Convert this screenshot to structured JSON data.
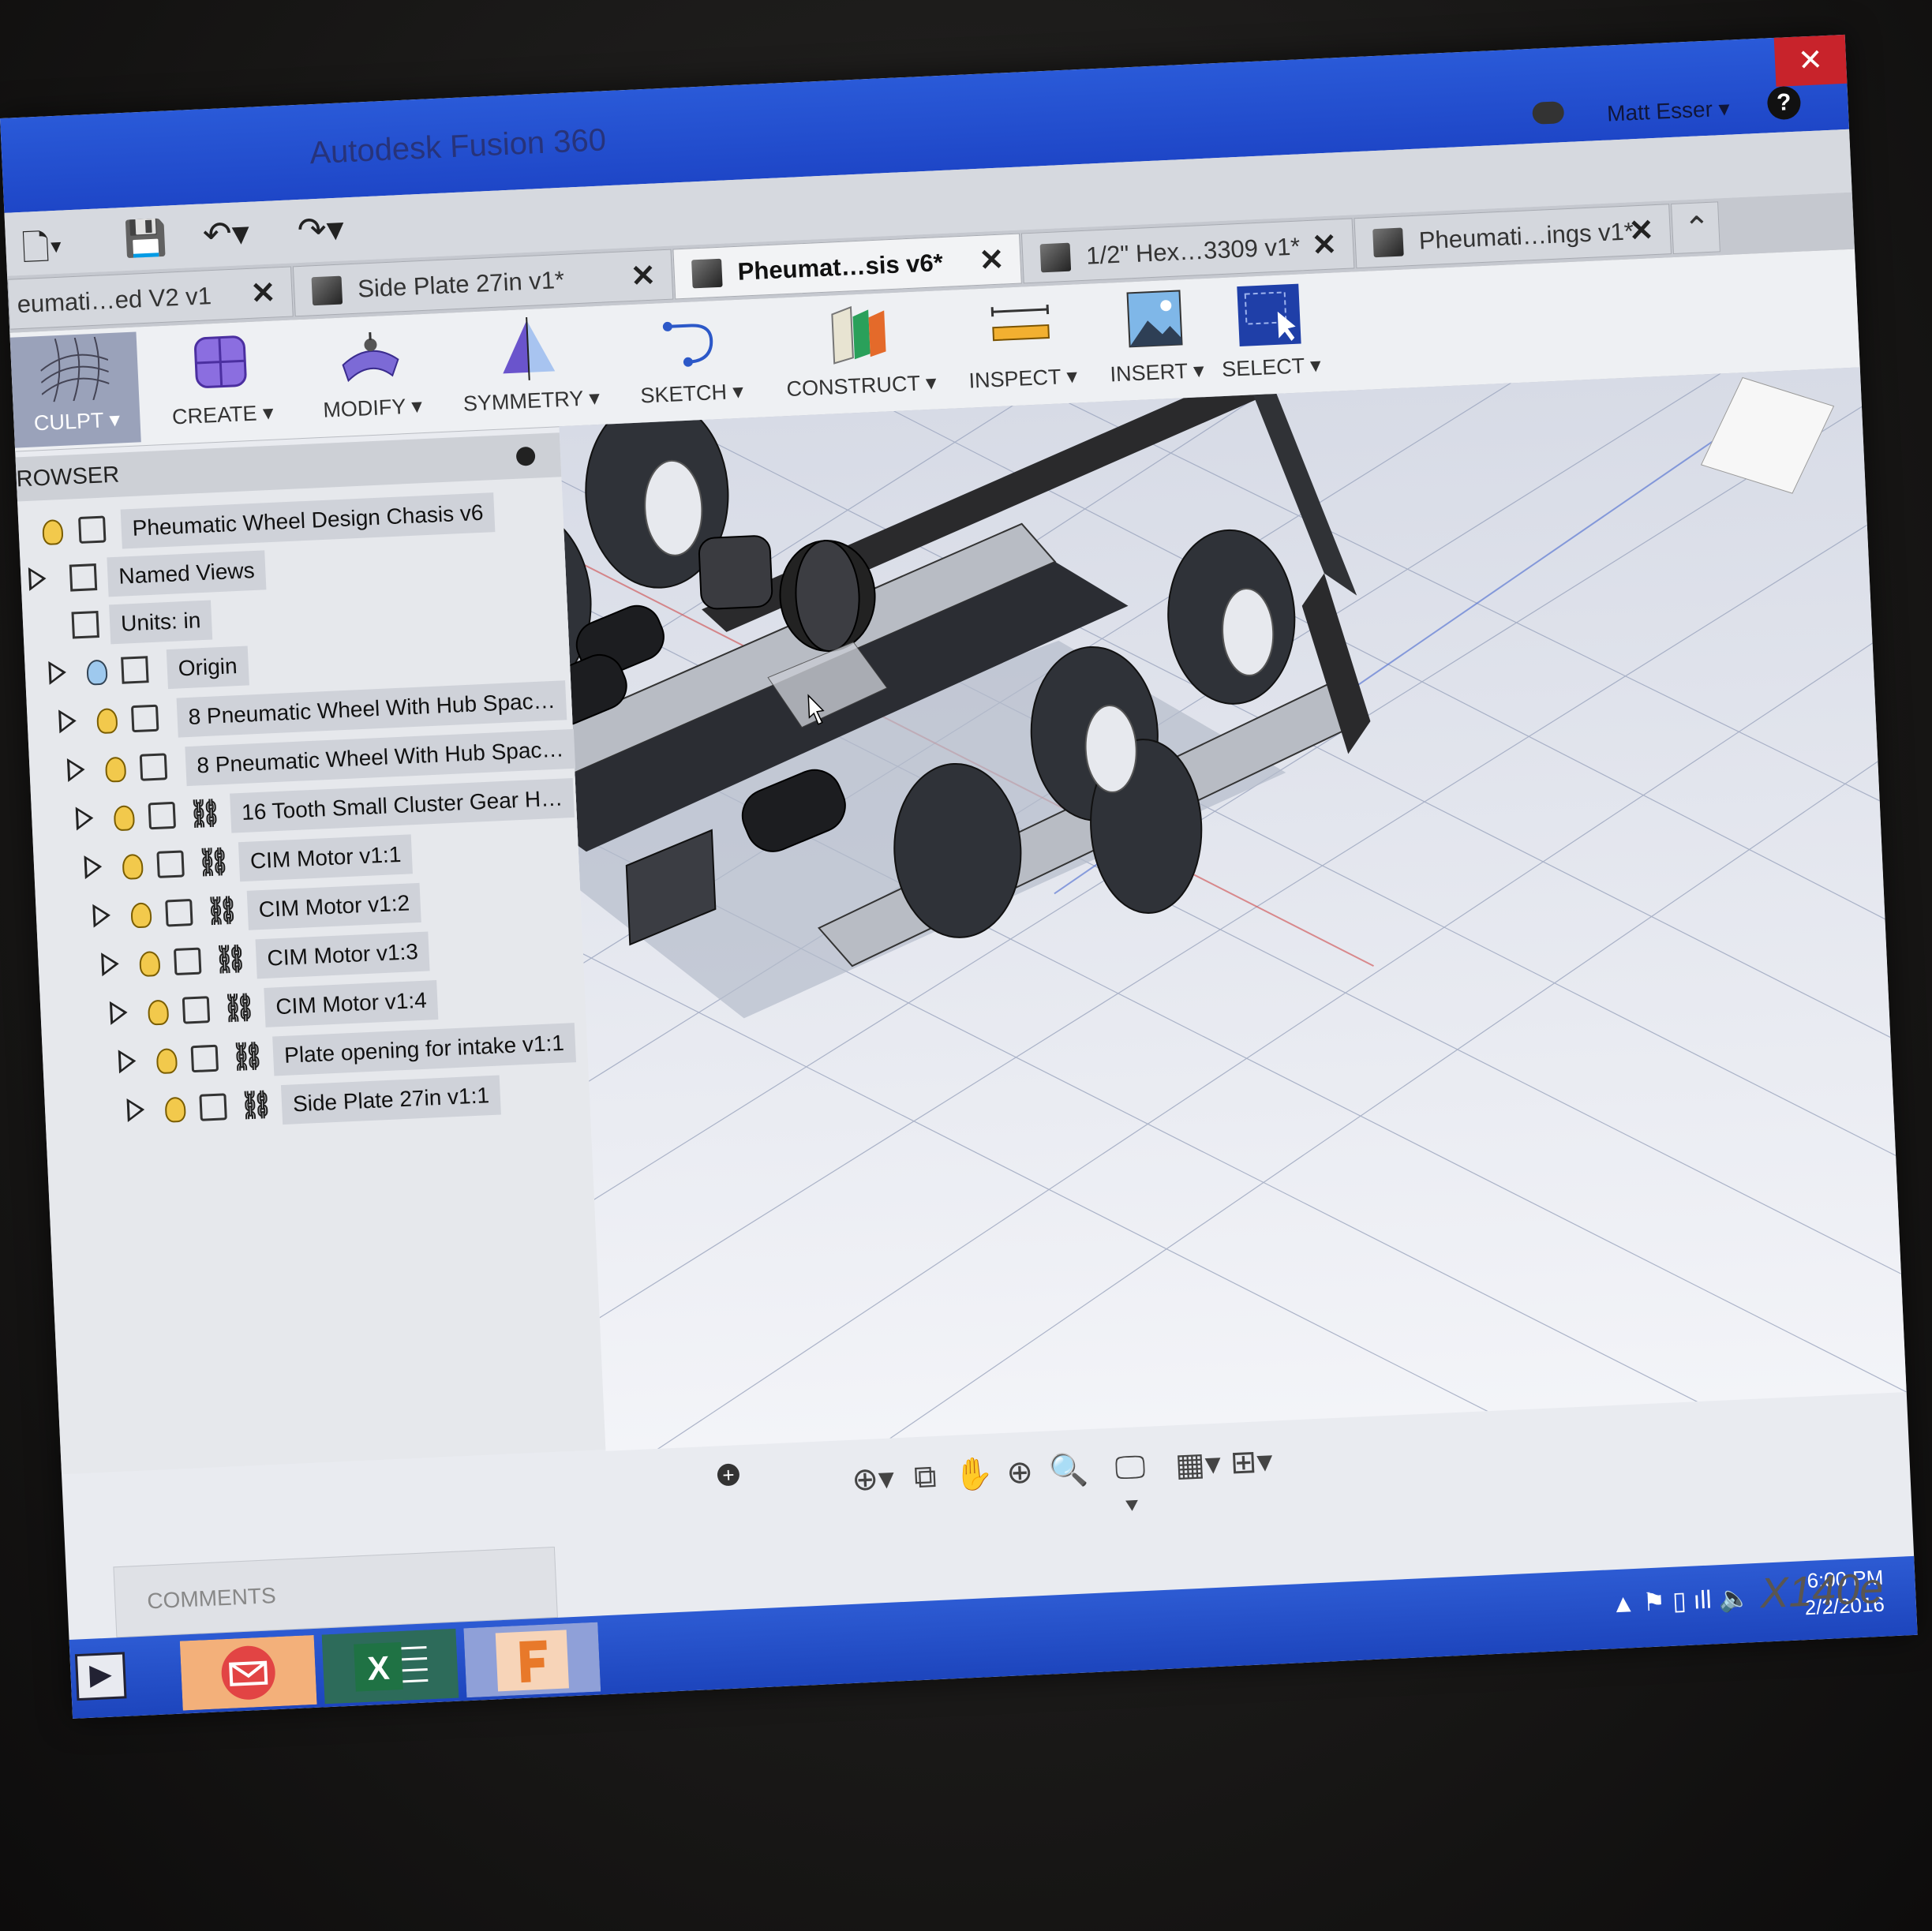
{
  "window": {
    "title": "Autodesk Fusion 360",
    "close_glyph": "✕"
  },
  "account": {
    "user": "Matt Esser ▾",
    "help": "?"
  },
  "quick_access": {
    "file": "🗋▾",
    "save": "💾",
    "undo": "↶▾",
    "redo": "↷▾"
  },
  "tabs": [
    {
      "label": "eumati…ed V2 v1",
      "active": false
    },
    {
      "label": "Side Plate 27in v1*",
      "active": false
    },
    {
      "label": "Pheumat…sis v6*",
      "active": true
    },
    {
      "label": "1/2\" Hex…3309 v1*",
      "active": false
    },
    {
      "label": "Pheumati…ings v1*",
      "active": false
    }
  ],
  "tab_close": "✕",
  "tab_overflow": "⌃",
  "ribbon": [
    {
      "label": "CULPT ▾",
      "icon": "sculpt-icon"
    },
    {
      "label": "CREATE ▾",
      "icon": "create-icon"
    },
    {
      "label": "MODIFY ▾",
      "icon": "modify-icon"
    },
    {
      "label": "SYMMETRY ▾",
      "icon": "symmetry-icon"
    },
    {
      "label": "SKETCH ▾",
      "icon": "sketch-icon"
    },
    {
      "label": "CONSTRUCT ▾",
      "icon": "construct-icon"
    },
    {
      "label": "INSPECT ▾",
      "icon": "inspect-icon"
    },
    {
      "label": "INSERT ▾",
      "icon": "insert-icon"
    },
    {
      "label": "SELECT ▾",
      "icon": "select-icon"
    }
  ],
  "browser": {
    "title": "ROWSER",
    "items": [
      {
        "label": "Pheumatic Wheel Design Chasis v6",
        "arrow": false,
        "bulb": "yellow",
        "link": false
      },
      {
        "label": "Named Views",
        "arrow": true,
        "bulb": "none",
        "link": false
      },
      {
        "label": "Units: in",
        "arrow": false,
        "bulb": "none",
        "link": false
      },
      {
        "label": "Origin",
        "arrow": true,
        "bulb": "blue",
        "link": false
      },
      {
        "label": "8 Pneumatic Wheel With Hub Spac…",
        "arrow": true,
        "bulb": "yellow",
        "link": false
      },
      {
        "label": "8 Pneumatic Wheel With Hub Spac…",
        "arrow": true,
        "bulb": "yellow",
        "link": false
      },
      {
        "label": "16 Tooth Small Cluster Gear H…",
        "arrow": true,
        "bulb": "yellow",
        "link": true
      },
      {
        "label": "CIM Motor v1:1",
        "arrow": true,
        "bulb": "yellow",
        "link": true
      },
      {
        "label": "CIM Motor v1:2",
        "arrow": true,
        "bulb": "yellow",
        "link": true
      },
      {
        "label": "CIM Motor v1:3",
        "arrow": true,
        "bulb": "yellow",
        "link": true
      },
      {
        "label": "CIM Motor v1:4",
        "arrow": true,
        "bulb": "yellow",
        "link": true
      },
      {
        "label": "Plate opening for intake v1:1",
        "arrow": true,
        "bulb": "yellow",
        "link": true
      },
      {
        "label": "Side Plate 27in v1:1",
        "arrow": true,
        "bulb": "yellow",
        "link": true
      }
    ]
  },
  "comments": {
    "label": "COMMENTS"
  },
  "navbar": [
    "⊕▾",
    "⧉",
    "✋",
    "⊕",
    "🔍",
    "🖵▾",
    "▦▾",
    "⊞▾"
  ],
  "tray": {
    "time": "6:00 PM",
    "date": "2/2/2016",
    "icons": "▲ ⚑ ▯ ıll 🔈"
  },
  "brand": "X140e",
  "colors": {
    "titlebar": "#1e46c7",
    "select_group": "#1f3fa8",
    "frame": "#b8bcc4"
  }
}
